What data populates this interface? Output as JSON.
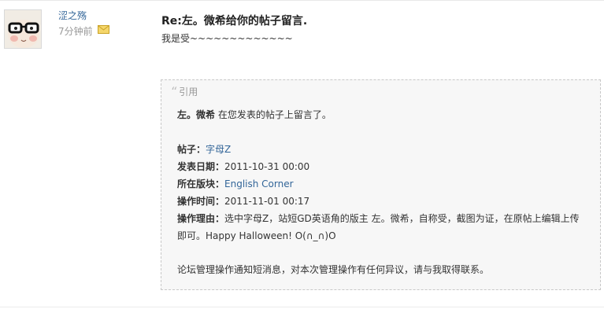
{
  "post": {
    "author": "涩之殇",
    "time": "7分钟前",
    "title": "Re:左。微希给你的帖子留言.",
    "body": "我是受~~~~~~~~~~~~~"
  },
  "quote": {
    "header": "引用",
    "intro_name": "左。微希",
    "intro_text": "在您发表的帖子上留言了。",
    "thread_label": "帖子：",
    "thread_value": "字母Z",
    "date_label": "发表日期：",
    "date_value": "2011-10-31 00:00",
    "board_label": "所在版块：",
    "board_value": "English Corner",
    "optime_label": "操作时间：",
    "optime_value": "2011-11-01 00:17",
    "reason_label": "操作理由：",
    "reason_line1": "选中字母Z，站短GD英语角的版主 左。微希，自称受，截图为证，在原帖上编辑上传",
    "reason_line2": "即可。Happy Halloween!   O(∩_∩)O",
    "footer": "论坛管理操作通知短消息，对本次管理操作有任何异议，请与我取得联系。"
  }
}
